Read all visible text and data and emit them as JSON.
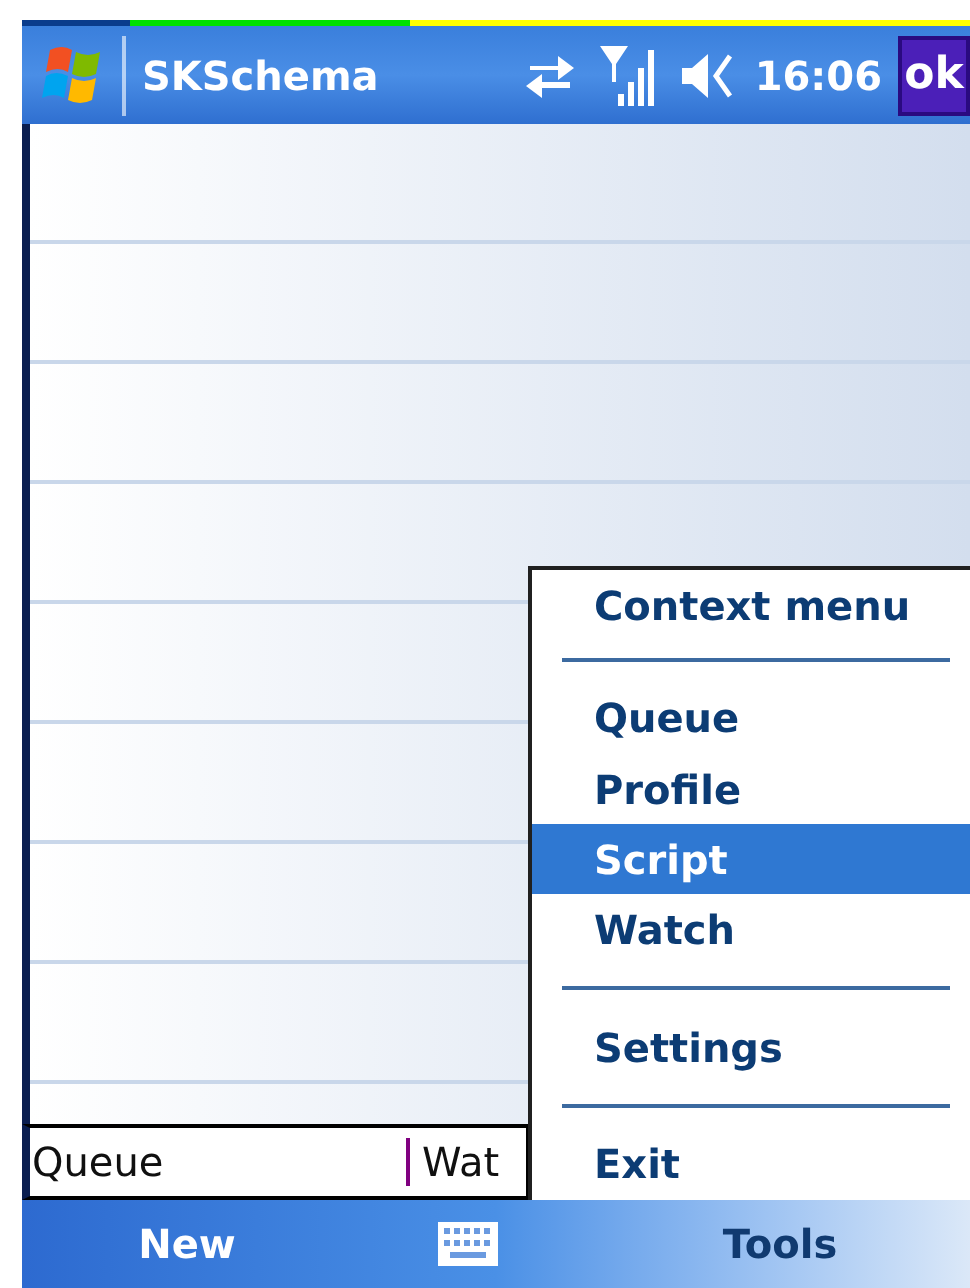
{
  "title_bar": {
    "title": "SKSchema",
    "time": "16:06",
    "ok_button": "ok"
  },
  "list": {
    "columns": [
      {
        "label": "Queue"
      },
      {
        "label": "Wat"
      }
    ]
  },
  "context_menu": {
    "items": [
      {
        "kind": "header",
        "label": "Context menu"
      },
      {
        "kind": "separator"
      },
      {
        "kind": "item",
        "label": "Queue",
        "selected": false
      },
      {
        "kind": "item",
        "label": "Profile",
        "selected": false
      },
      {
        "kind": "item",
        "label": "Script",
        "selected": true
      },
      {
        "kind": "item",
        "label": "Watch",
        "selected": false
      },
      {
        "kind": "separator"
      },
      {
        "kind": "item",
        "label": "Settings",
        "selected": false
      },
      {
        "kind": "separator"
      },
      {
        "kind": "item",
        "label": "Exit",
        "selected": false
      }
    ]
  },
  "menu_bar": {
    "left": "New",
    "right": "Tools"
  }
}
